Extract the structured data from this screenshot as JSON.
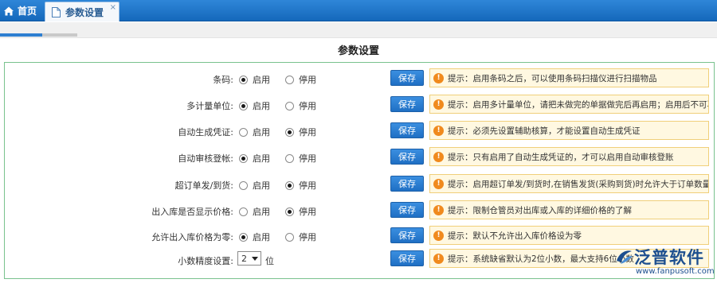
{
  "tabs": [
    {
      "label": "首页",
      "icon": "home-icon"
    },
    {
      "label": "参数设置",
      "icon": "document-icon",
      "close": "×"
    }
  ],
  "progress": {
    "fraction": 0.55
  },
  "page_title": "参数设置",
  "labels": {
    "enable": "启用",
    "disable": "停用",
    "save": "保存"
  },
  "settings": [
    {
      "label": "条码:",
      "selected": "enable",
      "tip": "提示：启用条码之后，可以使用条码扫描仪进行扫描物品"
    },
    {
      "label": "多计量单位:",
      "selected": "enable",
      "tip": "提示：启用多计量单位，请把未做完的单据做完后再启用；启用后不可再"
    },
    {
      "label": "自动生成凭证:",
      "selected": "disable",
      "tip": "提示：必须先设置辅助核算，才能设置自动生成凭证"
    },
    {
      "label": "自动审核登帐:",
      "selected": "enable",
      "tip": "提示：只有启用了自动生成凭证的，才可以启用自动审核登账"
    },
    {
      "label": "超订单发/到货:",
      "selected": "disable",
      "tip": "提示：启用超订单发/到货时,在销售发货(采购到货)时允许大于订单数量发"
    },
    {
      "label": "出入库是否显示价格:",
      "selected": "disable",
      "tip": "提示：限制仓管员对出库或入库的详细价格的了解"
    },
    {
      "label": "允许出入库价格为零:",
      "selected": "enable",
      "tip": "提示：默认不允许出入库价格设为零"
    }
  ],
  "decimal": {
    "label": "小数精度设置:",
    "value": "2",
    "unit": "位",
    "tip": "提示：系统缺省默认为2位小数，最大支持6位小数"
  },
  "watermark": {
    "brand": "泛普软件",
    "url": "www.fanpusoft.com"
  },
  "colors": {
    "tabbar": "#1a6ec4",
    "panel_border": "#79c28e",
    "tip_bg": "#fff8e1",
    "tip_icon": "#f08a1e",
    "button": "#2a7cd0"
  }
}
